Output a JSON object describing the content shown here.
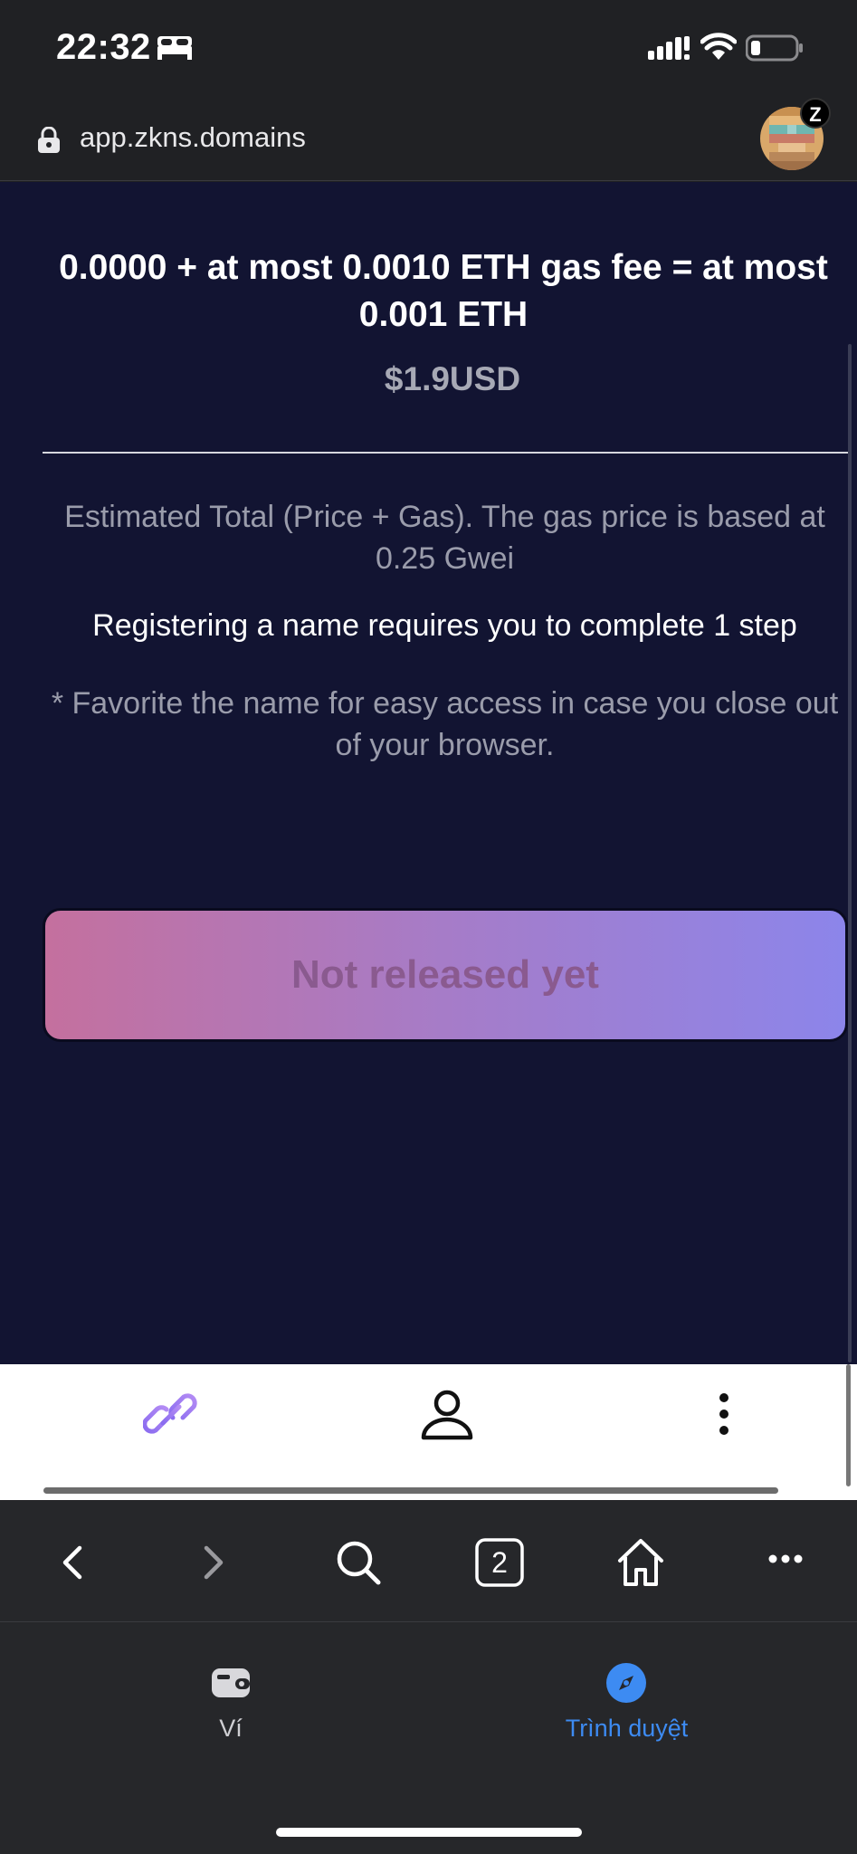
{
  "status_bar": {
    "time": "22:32"
  },
  "url_bar": {
    "url": "app.zkns.domains",
    "avatar_badge": "Z"
  },
  "main": {
    "fee_summary": "0.0000 + at most 0.0010 ETH gas fee = at most 0.001 ETH",
    "usd_value": "$1.9USD",
    "estimate_note": "Estimated Total (Price + Gas). The gas price is based at 0.25 Gwei",
    "steps_note": "Registering a name requires you to complete 1 step",
    "favorite_note": "* Favorite the name for easy access in case you close out of your browser.",
    "action_button": "Not released yet"
  },
  "browser_nav": {
    "tab_count": "2"
  },
  "bottom_tabs": [
    {
      "label": "Ví",
      "icon": "wallet-icon",
      "active": false
    },
    {
      "label": "Trình duyệt",
      "icon": "compass-icon",
      "active": true
    }
  ],
  "colors": {
    "page_background": "#121432",
    "chrome_background": "#26272a",
    "active_tab": "#3d8bf2",
    "button_gradient_start": "#c4709e",
    "button_gradient_end": "#8c85ea"
  }
}
